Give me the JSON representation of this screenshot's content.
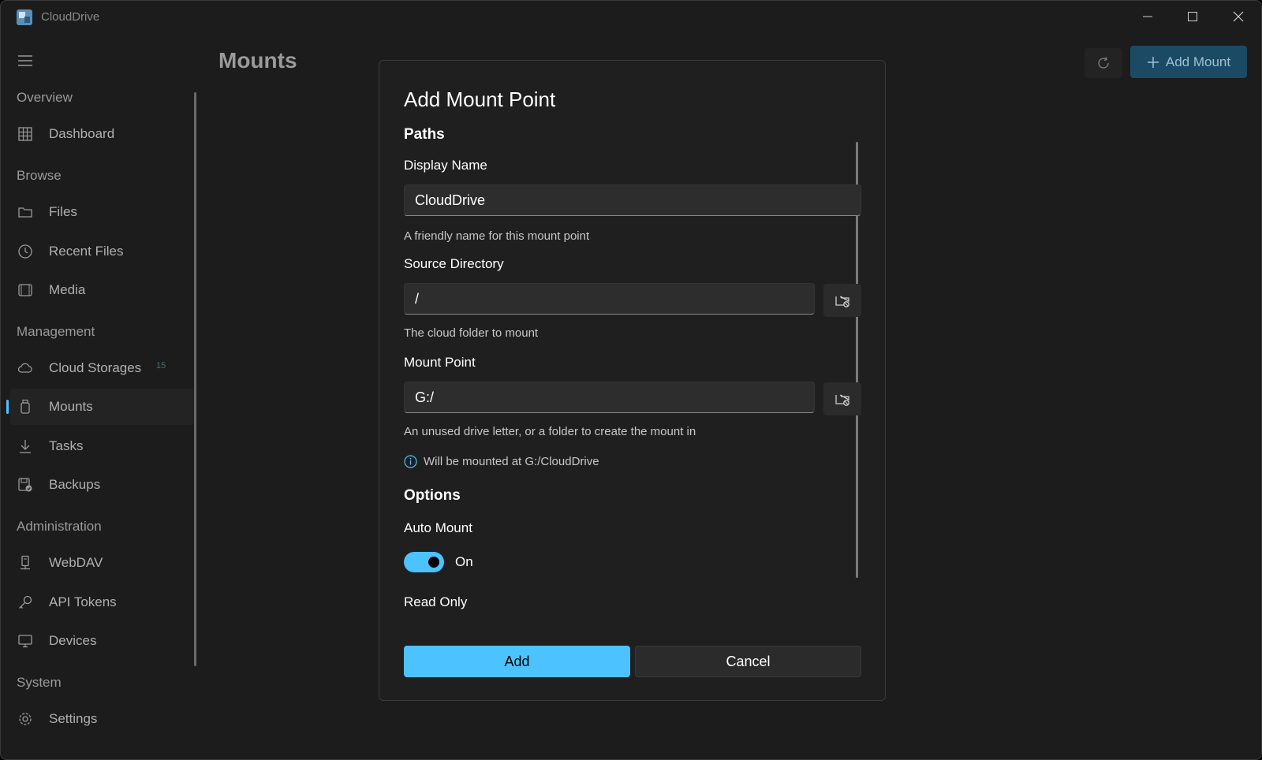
{
  "window": {
    "title": "CloudDrive"
  },
  "sidebar": {
    "sections": {
      "overview": "Overview",
      "browse": "Browse",
      "management": "Management",
      "administration": "Administration",
      "system": "System"
    },
    "items": {
      "dashboard": "Dashboard",
      "files": "Files",
      "recent_files": "Recent Files",
      "media": "Media",
      "cloud_storages": "Cloud Storages",
      "cloud_storages_badge": "15",
      "mounts": "Mounts",
      "tasks": "Tasks",
      "backups": "Backups",
      "webdav": "WebDAV",
      "api_tokens": "API Tokens",
      "devices": "Devices",
      "settings": "Settings"
    },
    "active_item": "mounts"
  },
  "main": {
    "title": "Mounts",
    "add_mount_label": "Add Mount"
  },
  "dialog": {
    "title": "Add Mount Point",
    "paths_heading": "Paths",
    "display_name": {
      "label": "Display Name",
      "value": "CloudDrive",
      "help": "A friendly name for this mount point"
    },
    "source_directory": {
      "label": "Source Directory",
      "value": "/",
      "help": "The cloud folder to mount"
    },
    "mount_point": {
      "label": "Mount Point",
      "value": "G:/",
      "help": "An unused drive letter, or a folder to create the mount in",
      "info": "Will be mounted at G:/CloudDrive"
    },
    "options_heading": "Options",
    "auto_mount": {
      "label": "Auto Mount",
      "state": "On"
    },
    "read_only": {
      "label": "Read Only"
    },
    "add_label": "Add",
    "cancel_label": "Cancel"
  },
  "colors": {
    "accent": "#4cc2ff",
    "background": "#1c1c1c",
    "dialog": "#1f1f1f"
  }
}
